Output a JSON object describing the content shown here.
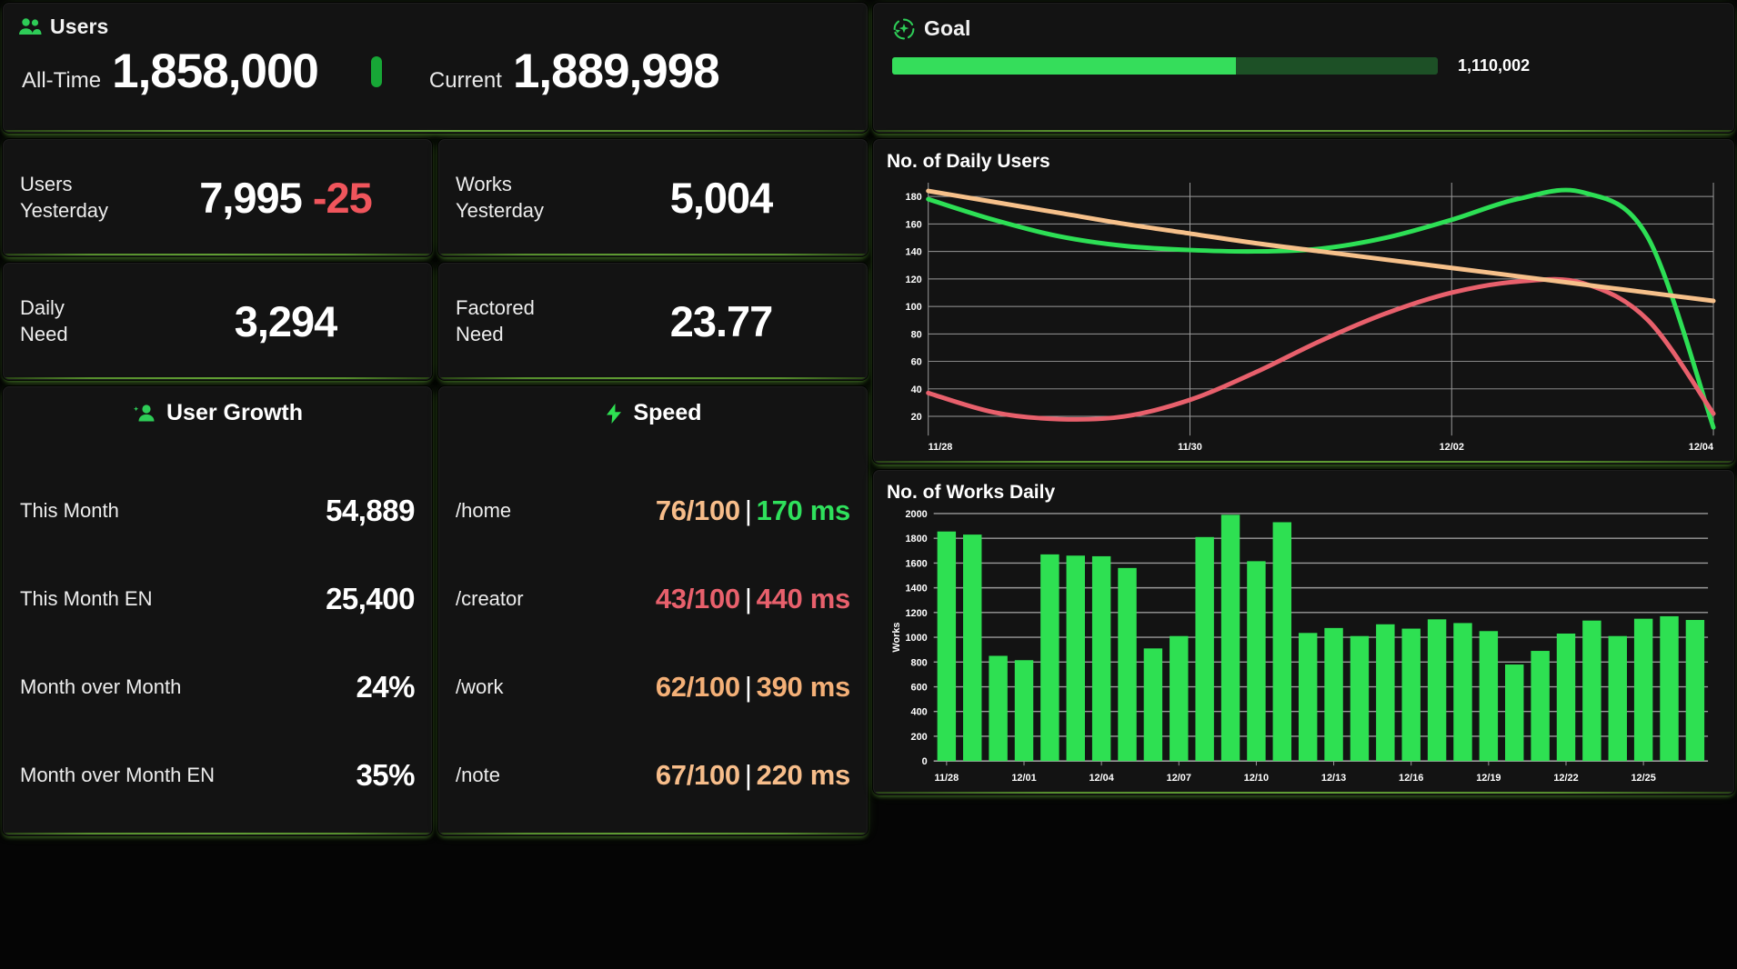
{
  "users_panel": {
    "title": "Users",
    "icon": "users-icon",
    "all_time_label": "All-Time",
    "all_time_value": "1,858,000",
    "current_label": "Current",
    "current_value": "1,889,998"
  },
  "goal_panel": {
    "title": "Goal",
    "icon": "goal-refresh-icon",
    "remaining_value": "1,110,002",
    "progress_percent": 63,
    "fill_color": "#35dd5b",
    "track_color": "#1d5026"
  },
  "stats": [
    {
      "label": "Users\nYesterday",
      "value": "7,995",
      "delta": "-25",
      "delta_color": "#f0555c"
    },
    {
      "label": "Works\nYesterday",
      "value": "5,004",
      "delta": "",
      "delta_color": ""
    },
    {
      "label": "Daily\nNeed",
      "value": "3,294",
      "delta": "",
      "delta_color": ""
    },
    {
      "label": "Factored\nNeed",
      "value": "23.77",
      "delta": "",
      "delta_color": ""
    }
  ],
  "user_growth": {
    "title": "User Growth",
    "icon": "user-add-icon",
    "rows": [
      {
        "key": "This Month",
        "value": "54,889"
      },
      {
        "key": "This Month EN",
        "value": "25,400"
      },
      {
        "key": "Month over Month",
        "value": "24%"
      },
      {
        "key": "Month over Month EN",
        "value": "35%"
      }
    ]
  },
  "speed": {
    "title": "Speed",
    "icon": "lightning-bolt-icon",
    "rows": [
      {
        "key": "/home",
        "score": "76/100",
        "score_color": "#f7bd8a",
        "time": "170 ms",
        "time_color": "#2fe05c"
      },
      {
        "key": "/creator",
        "score": "43/100",
        "score_color": "#e8606c",
        "time": "440 ms",
        "time_color": "#e8606c"
      },
      {
        "key": "/work",
        "score": "62/100",
        "score_color": "#f4b077",
        "time": "390 ms",
        "time_color": "#f4b077"
      },
      {
        "key": "/note",
        "score": "67/100",
        "score_color": "#f7bd8a",
        "time": "220 ms",
        "time_color": "#f7bd8a"
      }
    ]
  },
  "chart_data": [
    {
      "id": "daily-users-line-chart",
      "type": "line",
      "title": "No. of Daily Users",
      "xlabel": "",
      "ylabel": "",
      "ylim": [
        10,
        190
      ],
      "yticks": [
        20,
        40,
        60,
        80,
        100,
        120,
        140,
        160,
        180
      ],
      "xticks": [
        "11/28",
        "11/30",
        "12/02",
        "12/04"
      ],
      "xtick_positions": [
        0,
        2,
        4,
        6
      ],
      "xlim": [
        0,
        6
      ],
      "grid": true,
      "legend": "none",
      "x": [
        0,
        0.5,
        1,
        1.5,
        2,
        2.5,
        3,
        3.5,
        4,
        4.5,
        5,
        5.5,
        6
      ],
      "series": [
        {
          "name": "Green",
          "color": "#2ddf55",
          "values": [
            178,
            163,
            151,
            144,
            141,
            140,
            142,
            150,
            163,
            178,
            183,
            150,
            12
          ]
        },
        {
          "name": "Red",
          "color": "#e8606c",
          "values": [
            37,
            23,
            18,
            20,
            32,
            52,
            75,
            95,
            110,
            118,
            117,
            90,
            22
          ]
        },
        {
          "name": "Orange",
          "color": "#f6c08a",
          "values": [
            184,
            176,
            168,
            160,
            153,
            146,
            140,
            134,
            128,
            122,
            116,
            110,
            104
          ]
        }
      ]
    },
    {
      "id": "works-daily-bar-chart",
      "type": "bar",
      "title": "No. of Works Daily",
      "xlabel": "",
      "ylabel": "Works",
      "ylim": [
        0,
        2000
      ],
      "yticks": [
        0,
        200,
        400,
        600,
        800,
        1000,
        1200,
        1400,
        1600,
        1800,
        2000
      ],
      "bar_color": "#2ee052",
      "grid": true,
      "categories": [
        "11/28",
        "11/29",
        "11/30",
        "12/01",
        "12/02",
        "12/03",
        "12/04",
        "12/05",
        "12/06",
        "12/07",
        "12/08",
        "12/09",
        "12/10",
        "12/11",
        "12/12",
        "12/13",
        "12/14",
        "12/15",
        "12/16",
        "12/17",
        "12/18",
        "12/19",
        "12/20",
        "12/21",
        "12/22",
        "12/23",
        "12/24",
        "12/25",
        "12/26",
        "12/27"
      ],
      "xtick_labels": [
        "11/28",
        "12/01",
        "12/04",
        "12/07",
        "12/10",
        "12/13",
        "12/16",
        "12/19",
        "12/22",
        "12/25"
      ],
      "xtick_indices": [
        0,
        3,
        6,
        9,
        12,
        15,
        18,
        21,
        24,
        27
      ],
      "values": [
        1855,
        1830,
        850,
        815,
        1670,
        1660,
        1655,
        1560,
        910,
        1010,
        1810,
        1990,
        1615,
        1930,
        1035,
        1075,
        1010,
        1105,
        1070,
        1145,
        1115,
        1050,
        780,
        890,
        1030,
        1135,
        1010,
        1150,
        1170,
        1140
      ]
    }
  ]
}
